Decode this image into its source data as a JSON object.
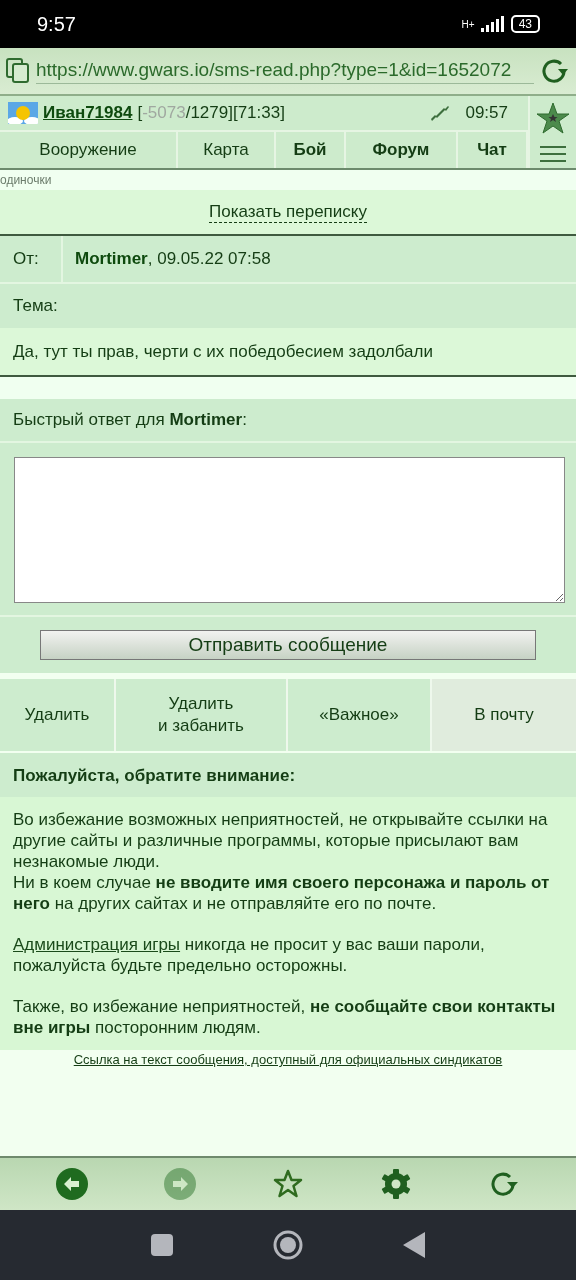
{
  "status_bar": {
    "time": "9:57",
    "network": "H+",
    "battery": "43"
  },
  "address_bar": {
    "url": "https://www.gwars.io/sms-read.php?type=1&id=1652072"
  },
  "player": {
    "name": "Иван71984",
    "stats": [
      {
        "text": "[",
        "faded": false
      },
      {
        "text": "-5073",
        "faded": true
      },
      {
        "text": "/1279][71:33]",
        "faded": false
      }
    ],
    "time": "09:57"
  },
  "nav": [
    {
      "label": "Вооружение",
      "bold": false
    },
    {
      "label": "Карта",
      "bold": false
    },
    {
      "label": "Бой",
      "bold": true
    },
    {
      "label": "Форум",
      "bold": true
    },
    {
      "label": "Чат",
      "bold": true
    }
  ],
  "section_label": "одиночки",
  "show_thread": "Показать переписку",
  "message": {
    "from_label": "От:",
    "from": "**Mortimer**, 09.05.22 07:58",
    "subject_label": "Тема:",
    "body": "Да, тут ты прав, черти с их победобесием задолбали"
  },
  "reply": {
    "heading": "Быстрый ответ для **Mortimer**:",
    "send": "Отправить сообщение"
  },
  "actions": [
    {
      "lines": [
        "Удалить"
      ],
      "kind": "plain"
    },
    {
      "lines": [
        "Удалить",
        "и забанить"
      ],
      "kind": "plain"
    },
    {
      "lines": [
        "«Важное»"
      ],
      "kind": "plain"
    },
    {
      "lines": [
        "В почту"
      ],
      "kind": "muted"
    }
  ],
  "notice": {
    "heading": "Пожалуйста, обратите внимание:",
    "paragraphs": [
      {
        "kind": "lines",
        "lines": [
          "Во избежание возможных неприятностей, не открывайте ссылки на другие сайты и различные программы, которые присылают вам незнакомые люди.",
          "Ни в коем случае **не вводите имя своего персонажа и пароль от него** на других сайтах и не отправляйте его по почте."
        ]
      },
      {
        "kind": "link",
        "link": "Администрация игры",
        "text": "никогда не просит у вас ваши пароли, пожалуйста будьте предельно осторожны."
      },
      {
        "kind": "lines",
        "lines": [
          "Также, во избежание неприятностей, **не сообщайте свои контакты вне игры** посторонним людям."
        ]
      }
    ]
  },
  "syndicate_link": "Ссылка на текст сообщения, доступный для официальных синдикатов",
  "toolbar": [
    {
      "kind": "back",
      "disabled": false
    },
    {
      "kind": "forward",
      "disabled": true
    },
    {
      "kind": "star",
      "disabled": false
    },
    {
      "kind": "settings",
      "disabled": false
    },
    {
      "kind": "reload",
      "disabled": false
    }
  ]
}
